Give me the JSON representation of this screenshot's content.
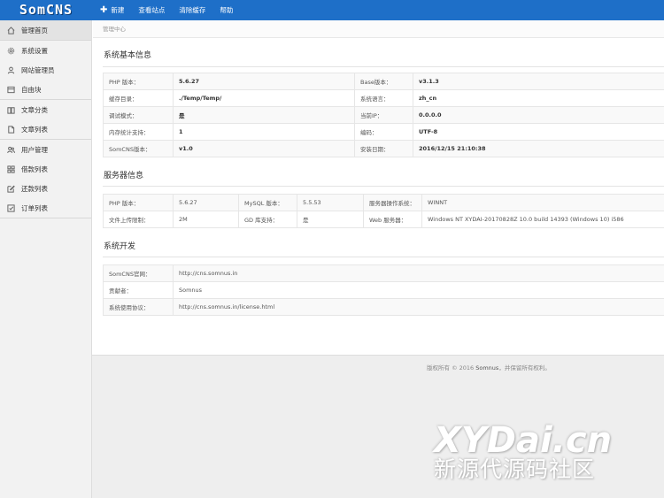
{
  "header": {
    "logo": "SomCNS",
    "nav": [
      {
        "label": "新建",
        "icon": "plus-icon"
      },
      {
        "label": "查看站点"
      },
      {
        "label": "清除缓存"
      },
      {
        "label": "帮助"
      }
    ],
    "bg_color": "#1e6fc8"
  },
  "sidebar": {
    "items": [
      {
        "label": "管理首页",
        "icon": "home-icon"
      },
      {
        "label": "系统设置",
        "icon": "gear-icon"
      },
      {
        "label": "网站管理员",
        "icon": "user-icon"
      },
      {
        "label": "自由块",
        "icon": "block-icon"
      },
      {
        "label": "文章分类",
        "icon": "book-icon"
      },
      {
        "label": "文章列表",
        "icon": "document-icon"
      },
      {
        "label": "用户管理",
        "icon": "users-icon"
      },
      {
        "label": "借款列表",
        "icon": "grid-icon"
      },
      {
        "label": "还款列表",
        "icon": "edit-icon"
      },
      {
        "label": "订单列表",
        "icon": "checkbox-icon"
      }
    ]
  },
  "breadcrumb": "管理中心",
  "sections": {
    "basic": {
      "title": "系统基本信息",
      "rows": [
        [
          "PHP 版本：",
          "5.6.27",
          "Base版本：",
          "v3.1.3"
        ],
        [
          "缓存目录：",
          "./Temp/Temp/",
          "系统语言：",
          "zh_cn"
        ],
        [
          "调试模式：",
          "是",
          "当前IP：",
          "0.0.0.0"
        ],
        [
          "内存统计支持：",
          "1",
          "编码：",
          "UTF-8"
        ],
        [
          "SomCNS版本：",
          "v1.0",
          "安装日期：",
          "2016/12/15 21:10:38"
        ]
      ]
    },
    "server": {
      "title": "服务器信息",
      "rows": [
        [
          "PHP 版本：",
          "5.6.27",
          "MySQL 版本：",
          "5.5.53",
          "服务器操作系统：",
          "WINNT"
        ],
        [
          "文件上传限制：",
          "2M",
          "GD 库支持：",
          "是",
          "Web 服务器：",
          "Windows NT XYDAI-20170828Z 10.0 build 14393 (Windows 10) i586"
        ]
      ]
    },
    "dev": {
      "title": "系统开发",
      "rows": [
        [
          "SomCNS官网：",
          "http://cns.somnus.in"
        ],
        [
          "贡献者：",
          "Somnus"
        ],
        [
          "系统使用协议：",
          "http://cns.somnus.in/license.html"
        ]
      ]
    }
  },
  "footer": {
    "prefix": "版权所有 © 2016 ",
    "brand": "Somnus",
    "suffix": "，并保留所有权利。"
  },
  "watermark": {
    "top": "XYDai.cn",
    "bottom": "新源代源码社区"
  }
}
